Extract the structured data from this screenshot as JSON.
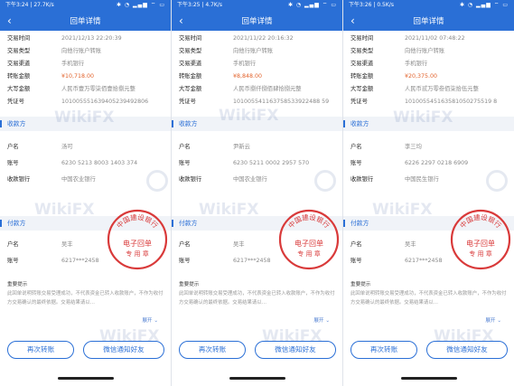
{
  "screens": [
    {
      "status": {
        "time": "下午3:24",
        "speed": "27.7K/s",
        "icons": "✱ ◔ ▂▄▆ ⌔ ▭"
      },
      "nav": {
        "back": "‹",
        "title": "回单详情"
      },
      "rows": [
        {
          "label": "交易时间",
          "value": "2021/12/13 22:20:39"
        },
        {
          "label": "交易类型",
          "value": "向他行账户转账"
        },
        {
          "label": "交易渠道",
          "value": "手机银行"
        },
        {
          "label": "转账金额",
          "value": "¥10,718.00"
        },
        {
          "label": "大写金额",
          "value": "人民币壹万零柒佰壹拾捌元整"
        },
        {
          "label": "凭证号",
          "value": "101005551639405239492806"
        }
      ],
      "payee_title": "收款方",
      "payee": [
        {
          "label": "户名",
          "value": "汤可"
        },
        {
          "label": "账号",
          "value": "6230 5213 8003 1403 374"
        },
        {
          "label": "收款银行",
          "value": "中国农业银行"
        }
      ],
      "payer_title": "付款方",
      "payer": [
        {
          "label": "户名",
          "value": "吴丰"
        },
        {
          "label": "账号",
          "value": "6217***2458"
        }
      ],
      "notice_title": "重要提示",
      "notice": "此回单说明转账交易受理成功，不代表资金已转入收款账户，不作为收付方交易确认的最终依据。交易结果请以…",
      "expand": "展开",
      "btn_again": "再次转账",
      "btn_wechat": "微信通知好友"
    },
    {
      "status": {
        "time": "下午3:25",
        "speed": "4.7K/s",
        "icons": "✱ ◔ ▂▄▆ ⌔ ▭"
      },
      "nav": {
        "back": "‹",
        "title": "回单详情"
      },
      "rows": [
        {
          "label": "交易时间",
          "value": "2021/11/22 20:16:32"
        },
        {
          "label": "交易类型",
          "value": "向他行账户转账"
        },
        {
          "label": "交易渠道",
          "value": "手机银行"
        },
        {
          "label": "转账金额",
          "value": "¥8,848.00"
        },
        {
          "label": "大写金额",
          "value": "人民币捌仟捌佰肆拾捌元整"
        },
        {
          "label": "凭证号",
          "value": "101005541163758533922488 59"
        }
      ],
      "payee_title": "收款方",
      "payee": [
        {
          "label": "户名",
          "value": "尹新云"
        },
        {
          "label": "账号",
          "value": "6230 5211 0002 2957 570"
        },
        {
          "label": "收款银行",
          "value": "中国农业银行"
        }
      ],
      "payer_title": "付款方",
      "payer": [
        {
          "label": "户名",
          "value": "吴丰"
        },
        {
          "label": "账号",
          "value": "6217***2458"
        }
      ],
      "notice_title": "重要提示",
      "notice": "此回单说明转账交易受理成功，不代表资金已转入收款账户，不作为收付方交易确认的最终依据。交易结果请以…",
      "expand": "展开",
      "btn_again": "再次转账",
      "btn_wechat": "微信通知好友"
    },
    {
      "status": {
        "time": "下午3:26",
        "speed": "0.5K/s",
        "icons": "✱ ◔ ▂▄▆ ⌔ ▭"
      },
      "nav": {
        "back": "‹",
        "title": "回单详情"
      },
      "rows": [
        {
          "label": "交易时间",
          "value": "2021/11/02 07:48:22"
        },
        {
          "label": "交易类型",
          "value": "向他行账户转账"
        },
        {
          "label": "交易渠道",
          "value": "手机银行"
        },
        {
          "label": "转账金额",
          "value": "¥20,375.00"
        },
        {
          "label": "大写金额",
          "value": "人民币贰万零叁佰柒拾伍元整"
        },
        {
          "label": "凭证号",
          "value": "101005545163581050275519 8"
        }
      ],
      "payee_title": "收款方",
      "payee": [
        {
          "label": "户名",
          "value": "李三均"
        },
        {
          "label": "账号",
          "value": "6226 2297 0218 6909"
        },
        {
          "label": "收款银行",
          "value": "中国民生银行"
        }
      ],
      "payer_title": "付款方",
      "payer": [
        {
          "label": "户名",
          "value": "吴丰"
        },
        {
          "label": "账号",
          "value": "6217***2458"
        }
      ],
      "notice_title": "重要提示",
      "notice": "此回单说明转账交易受理成功，不代表资金已转入收款账户，不作为收付方交易确认的最终依据。交易结果请以…",
      "expand": "展开",
      "btn_again": "再次转账",
      "btn_wechat": "微信通知好友"
    }
  ],
  "stamp": {
    "arc_text": "中国建设银行",
    "line1": "电子回单",
    "line2": "专 用 章",
    "color": "#d93a3a"
  },
  "watermark": "WikiFX",
  "colors": {
    "brand": "#2a6fd6",
    "amount": "#e2622b",
    "section_bg": "#f0f3f8"
  }
}
